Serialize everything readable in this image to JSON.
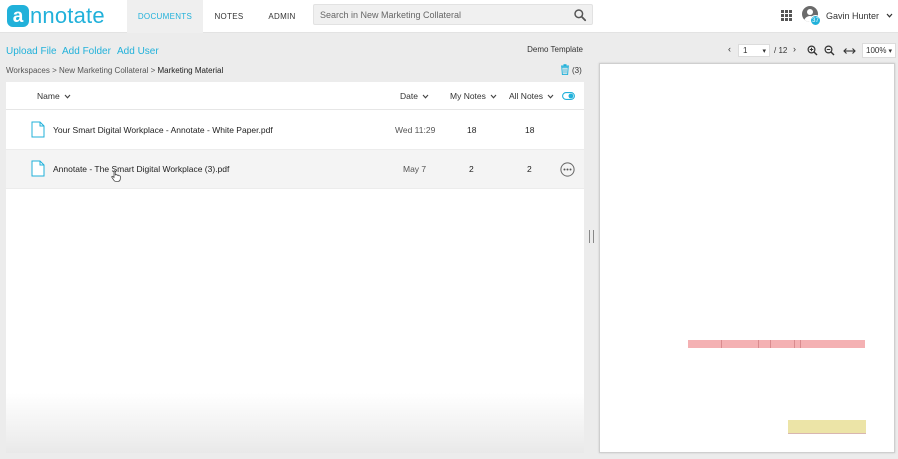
{
  "app": {
    "logo_letter": "a",
    "logo_text": "nnotate",
    "brand_color": "#21b1da"
  },
  "nav": {
    "tabs": [
      {
        "label": "DOCUMENTS",
        "active": true
      },
      {
        "label": "NOTES",
        "active": false
      },
      {
        "label": "ADMIN",
        "active": false
      }
    ]
  },
  "search": {
    "placeholder": "Search in New Marketing Collateral",
    "icon": "search-icon"
  },
  "user": {
    "name": "Gavin Hunter",
    "badge_count": "37"
  },
  "actions": {
    "upload_file": "Upload File",
    "add_folder": "Add Folder",
    "add_user": "Add User"
  },
  "template_name": "Demo Template",
  "breadcrumb": {
    "path": "Workspaces > New Marketing Collateral > ",
    "current": "Marketing Material"
  },
  "trash": {
    "count": "(3)"
  },
  "table": {
    "columns": {
      "name": "Name",
      "date": "Date",
      "my_notes": "My Notes",
      "all_notes": "All Notes"
    },
    "rows": [
      {
        "name": "Your Smart Digital Workplace - Annotate - White Paper.pdf",
        "date": "Wed 11:29",
        "my_notes": "18",
        "all_notes": "18"
      },
      {
        "name": "Annotate - The Smart Digital Workplace (3).pdf",
        "date": "May 7",
        "my_notes": "2",
        "all_notes": "2"
      }
    ]
  },
  "viewer": {
    "prev": "‹",
    "next": "›",
    "page_current": "1",
    "page_total": "/ 12",
    "zoom": "100%",
    "highlight_colors": {
      "red": "#f4b1b3",
      "yellow": "#ece4a7"
    }
  }
}
